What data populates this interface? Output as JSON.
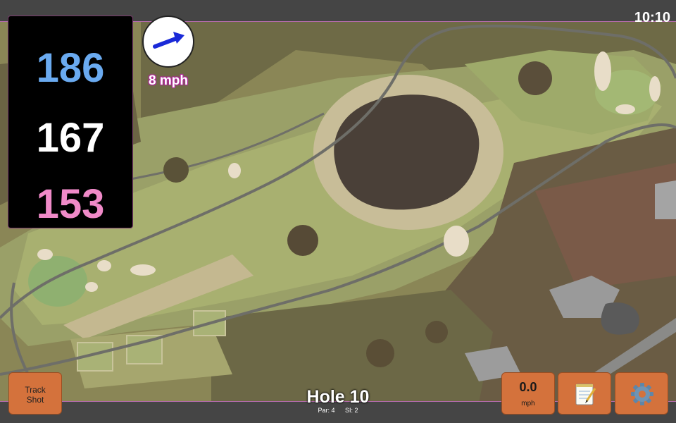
{
  "status": {
    "time": "10:10"
  },
  "distances": {
    "back": "186",
    "middle": "167",
    "front": "153",
    "back_color": "#6aaaf0",
    "middle_color": "#ffffff",
    "front_color": "#f08ac8"
  },
  "wind": {
    "speed": "8 mph",
    "arrow_color": "#1a2ad8",
    "icon": "wind-direction-arrow-icon"
  },
  "track_shot": {
    "label_line1": "Track",
    "label_line2": "Shot"
  },
  "speed_display": {
    "value": "0.0",
    "unit": "mph"
  },
  "notes": {
    "icon": "notepad-icon"
  },
  "settings": {
    "icon": "gear-icon"
  },
  "hole": {
    "title": "Hole 10",
    "par": "Par: 4",
    "si": "SI: 2"
  },
  "colors": {
    "button": "#d4723c",
    "bar": "#454545",
    "panel": "#000000"
  }
}
